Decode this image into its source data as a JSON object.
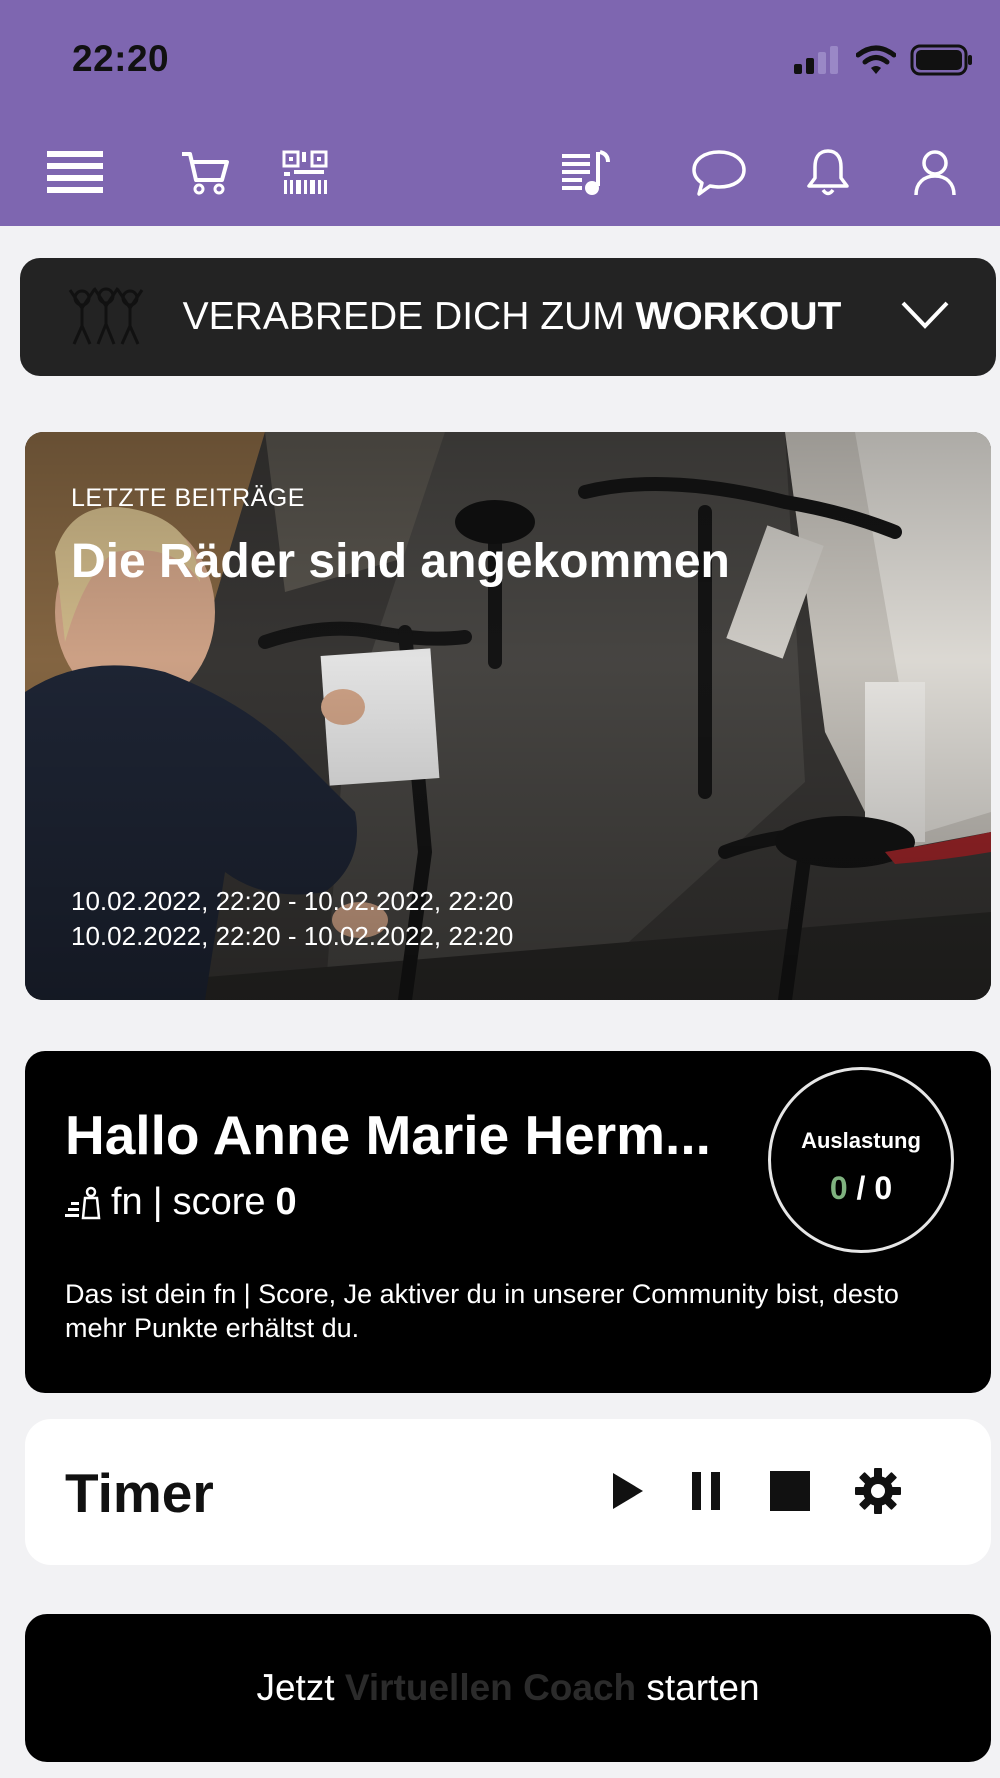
{
  "status_bar": {
    "time": "22:20"
  },
  "navbar": {
    "icons": [
      "menu-icon",
      "cart-icon",
      "qr-code-icon",
      "playlist-icon",
      "chat-icon",
      "bell-icon",
      "user-icon"
    ]
  },
  "workout_banner": {
    "prefix": "VERABREDE DICH ZUM ",
    "emphasis": "WORKOUT"
  },
  "latest_post": {
    "kicker": "LETZTE BEITRÄGE",
    "title": "Die Räder sind angekommen",
    "dates": [
      "10.02.2022, 22:20 - 10.02.2022, 22:20",
      "10.02.2022, 22:20 - 10.02.2022, 22:20"
    ]
  },
  "profile": {
    "greeting": "Hallo Anne Marie Herm...",
    "score_brand": "fn",
    "score_label": "score",
    "score_value": "0",
    "description": "Das ist dein fn | Score, Je aktiver du in unserer Community bist, desto mehr Punkte erhältst du.",
    "load": {
      "label": "Auslastung",
      "current": "0",
      "separator": " / ",
      "max": "0"
    }
  },
  "timer": {
    "title": "Timer"
  },
  "coach_button": {
    "prefix": "Jetzt ",
    "highlight": "Virtuellen Coach",
    "suffix": " starten"
  },
  "colors": {
    "header": "#7e66b0",
    "banner": "#232323",
    "card": "#000000",
    "load_current": "#7fb27f"
  }
}
